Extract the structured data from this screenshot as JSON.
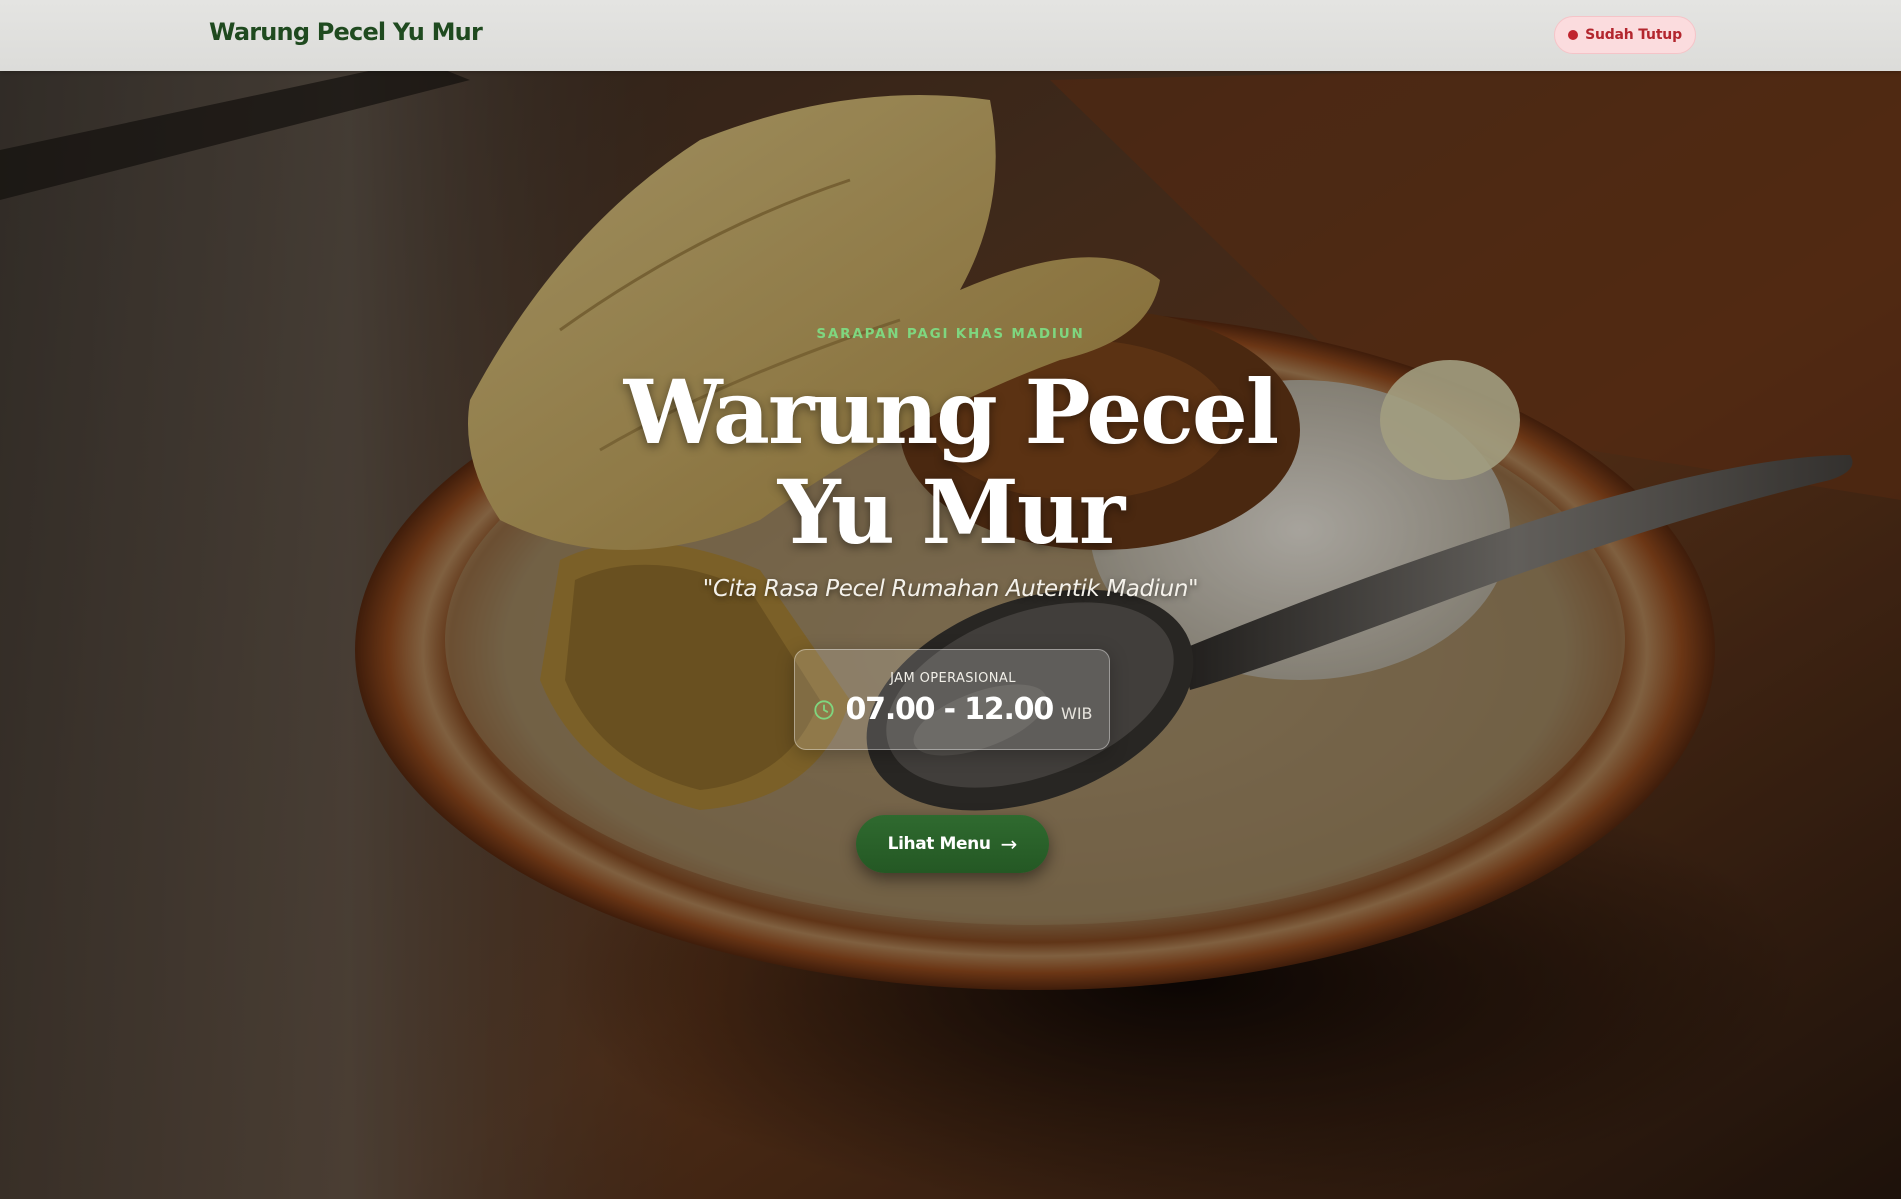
{
  "navbar": {
    "brand": "Warung Pecel Yu Mur",
    "status": {
      "label": "Sudah Tutup",
      "dot_color": "#c0242e",
      "background": "#fbdcde"
    }
  },
  "hero": {
    "background_image": "pecel rice plate with rempeyek, tempeh and spoon on a wooden table",
    "eyebrow": "SARAPAN PAGI KHAS MADIUN",
    "title_line1": "Warung Pecel",
    "title_line2": "Yu Mur",
    "tagline": "\"Cita Rasa Pecel Rumahan Autentik Madiun\"",
    "hours": {
      "label": "JAM OPERASIONAL",
      "icon": "clock-icon",
      "time": "07.00 - 12.00",
      "unit": "WIB"
    },
    "cta": {
      "label": "Lihat Menu",
      "icon": "arrow-right-icon"
    }
  },
  "colors": {
    "brand_green": "#1f4a1f",
    "accent_green": "#7fd67f",
    "button_green": "#2f6a2f",
    "closed_red": "#b3262e"
  }
}
